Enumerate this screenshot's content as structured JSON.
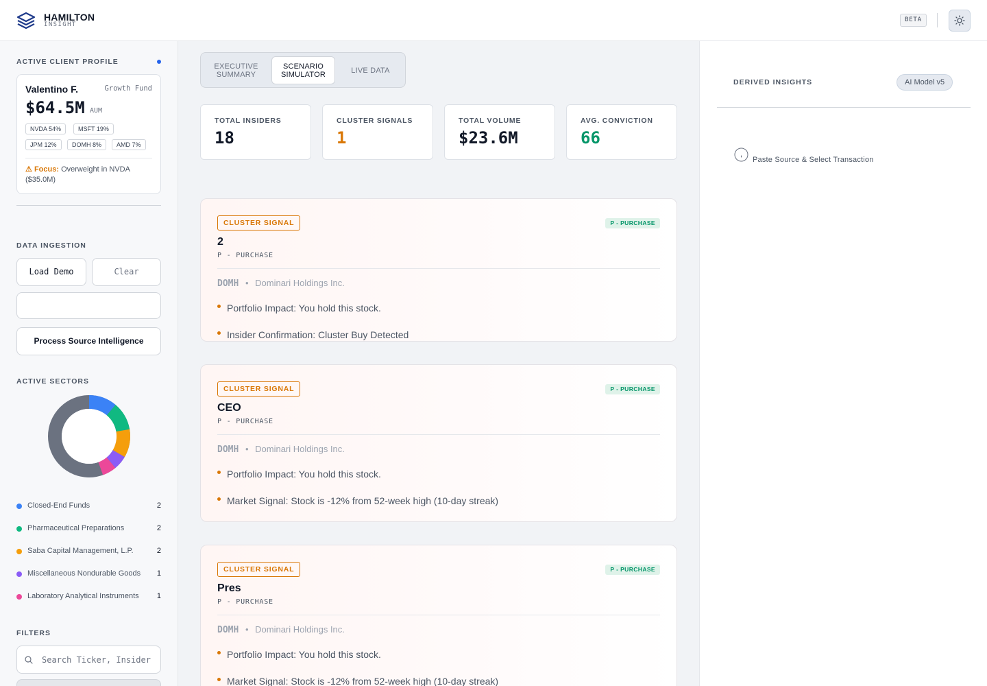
{
  "header": {
    "brand": "HAMILTON",
    "brand_sub": "INSIGHT",
    "beta": "BETA",
    "logo_icon": "stacked-layers-icon",
    "theme_icon": "sun-icon"
  },
  "sidebar": {
    "profile": {
      "section_title": "ACTIVE CLIENT PROFILE",
      "client_name": "Valentino F.",
      "client_type": "Growth Fund",
      "aum": "$64.5M",
      "aum_label": "AUM",
      "holdings": [
        "NVDA 54%",
        "MSFT 19%",
        "JPM 12%",
        "DOMH 8%",
        "AMD 7%"
      ],
      "focus_label": "Focus:",
      "focus_text": "Overweight in NVDA ($35.0M)"
    },
    "ingestion": {
      "section_title": "DATA INGESTION",
      "load_demo": "Load Demo",
      "clear": "Clear",
      "input_value": "",
      "process": "Process Source Intelligence"
    },
    "sectors": {
      "section_title": "ACTIVE SECTORS",
      "items": [
        {
          "name": "Closed-End Funds",
          "count": "2",
          "color": "#3b82f6"
        },
        {
          "name": "Pharmaceutical Preparations",
          "count": "2",
          "color": "#10b981"
        },
        {
          "name": "Saba Capital Management, L.P.",
          "count": "2",
          "color": "#f59e0b"
        },
        {
          "name": "Miscellaneous Nondurable Goods",
          "count": "1",
          "color": "#8b5cf6"
        },
        {
          "name": "Laboratory Analytical Instruments",
          "count": "1",
          "color": "#ec4899"
        }
      ],
      "remainder_color": "#6b7280"
    },
    "filters": {
      "section_title": "FILTERS",
      "search_placeholder": "Search Ticker, Insider"
    }
  },
  "tabs": [
    {
      "label_line1": "EXECUTIVE",
      "label_line2": "SUMMARY",
      "active": false
    },
    {
      "label_line1": "SCENARIO",
      "label_line2": "SIMULATOR",
      "active": true
    },
    {
      "label_line1": "LIVE DATA",
      "label_line2": "",
      "active": false
    }
  ],
  "stats": [
    {
      "label": "TOTAL INSIDERS",
      "value": "18",
      "color": "#111827"
    },
    {
      "label": "CLUSTER SIGNALS",
      "value": "1",
      "color": "#d97706"
    },
    {
      "label": "TOTAL VOLUME",
      "value": "$23.6M",
      "color": "#111827"
    },
    {
      "label": "AVG. CONVICTION",
      "value": "66",
      "color": "#059669"
    }
  ],
  "signals": [
    {
      "badge": "CLUSTER SIGNAL",
      "type_badge": "P - PURCHASE",
      "title": "2",
      "subtitle": "P - PURCHASE",
      "ticker": "DOMH",
      "company": "Dominari Holdings Inc.",
      "bullets": [
        "Portfolio Impact: You hold this stock.",
        "Insider Confirmation: Cluster Buy Detected"
      ]
    },
    {
      "badge": "CLUSTER SIGNAL",
      "type_badge": "P - PURCHASE",
      "title": "CEO",
      "subtitle": "P - PURCHASE",
      "ticker": "DOMH",
      "company": "Dominari Holdings Inc.",
      "bullets": [
        "Portfolio Impact: You hold this stock.",
        "Market Signal: Stock is -12% from 52-week high (10-day streak)"
      ]
    },
    {
      "badge": "CLUSTER SIGNAL",
      "type_badge": "P - PURCHASE",
      "title": "Pres",
      "subtitle": "P - PURCHASE",
      "ticker": "DOMH",
      "company": "Dominari Holdings Inc.",
      "bullets": [
        "Portfolio Impact: You hold this stock.",
        "Market Signal: Stock is -12% from 52-week high (10-day streak)"
      ]
    }
  ],
  "insights": {
    "title": "DERIVED INSIGHTS",
    "model": "AI Model v5",
    "hint": "Paste Source & Select Transaction",
    "hint_icon": "info-icon"
  }
}
